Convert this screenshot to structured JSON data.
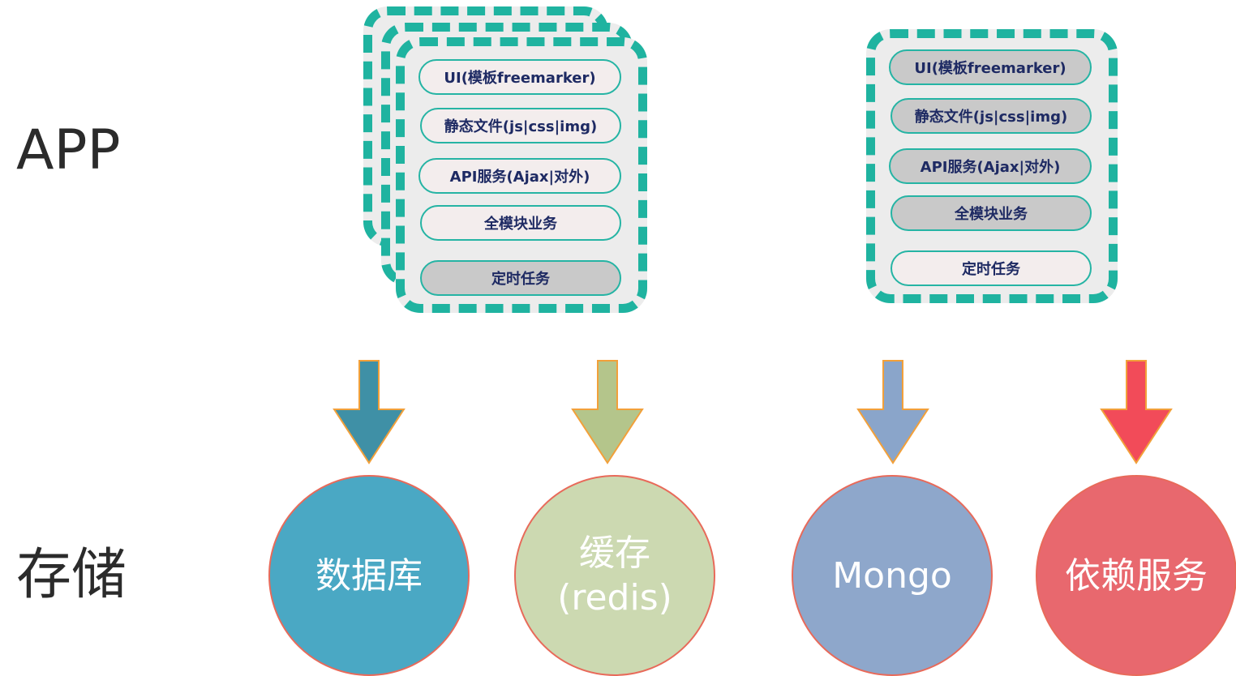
{
  "rows": {
    "app": "APP",
    "storage": "存储"
  },
  "app_left": {
    "items": [
      {
        "label": "UI(模板freemarker)",
        "shaded": false
      },
      {
        "label": "静态文件(js|css|img)",
        "shaded": false
      },
      {
        "label": "API服务(Ajax|对外)",
        "shaded": false
      },
      {
        "label": "全模块业务",
        "shaded": false
      },
      {
        "label": "定时任务",
        "shaded": true
      }
    ]
  },
  "app_right": {
    "items": [
      {
        "label": "UI(模板freemarker)",
        "shaded": true
      },
      {
        "label": "静态文件(js|css|img)",
        "shaded": true
      },
      {
        "label": "API服务(Ajax|对外)",
        "shaded": true
      },
      {
        "label": "全模块业务",
        "shaded": true
      },
      {
        "label": "定时任务",
        "shaded": false
      }
    ]
  },
  "storage": [
    {
      "line1": "数据库",
      "line2": "",
      "color": "#4aa8c4",
      "arrow_color": "#3f90a6"
    },
    {
      "line1": "缓存",
      "line2": "(redis)",
      "color": "#ccd9b1",
      "arrow_color": "#b4c58b"
    },
    {
      "line1": "Mongo",
      "line2": "",
      "color": "#8ea7cb",
      "arrow_color": "#8aa5ca"
    },
    {
      "line1": "依赖服务",
      "line2": "",
      "color": "#e8686e",
      "arrow_color": "#f24b59"
    }
  ],
  "colors": {
    "dash_border": "#1fb3a0",
    "pill_border": "#25b4a4",
    "pill_text": "#1e2a63",
    "arrow_outline": "#f2a03a"
  }
}
